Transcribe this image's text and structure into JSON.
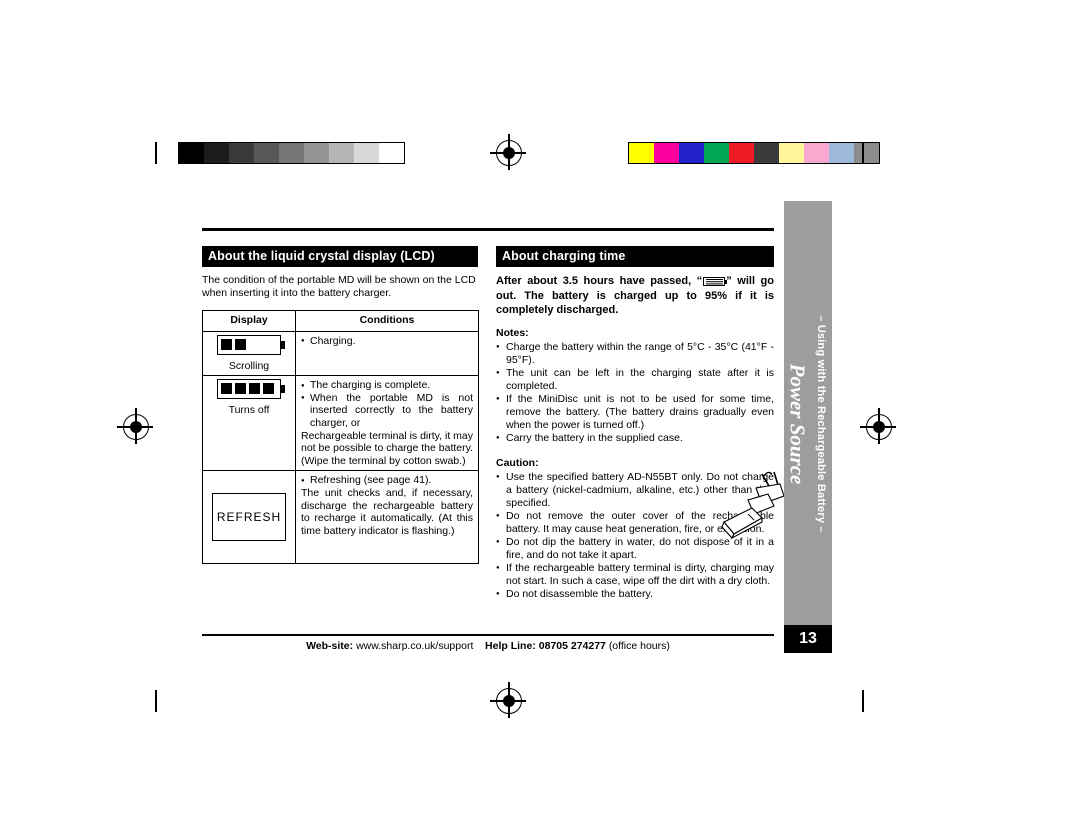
{
  "page": {
    "number": "13",
    "footer_websites_label": "Web-site:",
    "footer_website": "www.sharp.co.uk/support",
    "footer_helpline_label": "Help Line:",
    "footer_helpline": "08705 274277",
    "footer_helpline_suffix": "(office hours)"
  },
  "side_tab": {
    "title": "Power Source",
    "subtitle": "– Using with the Rechargeable Battery –"
  },
  "left": {
    "heading": "About the liquid crystal display (LCD)",
    "intro": "The condition of the portable MD will be shown on the LCD when inserting it into the battery charger.",
    "table": {
      "headers": [
        "Display",
        "Conditions"
      ],
      "rows": [
        {
          "display_icon": "battery-scrolling-icon",
          "display_label": "Scrolling",
          "conditions": [
            {
              "bullet": true,
              "text": "Charging."
            }
          ]
        },
        {
          "display_icon": "battery-off-icon",
          "display_label": "Turns off",
          "conditions": [
            {
              "bullet": true,
              "text": "The charging is complete."
            },
            {
              "bullet": true,
              "text": "When the portable MD is not inserted correctly to the battery charger, or"
            },
            {
              "bullet": false,
              "text": "Rechargeable terminal is dirty, it may not be possible to charge the battery. (Wipe the terminal by cotton swab.)"
            }
          ]
        },
        {
          "display_icon": "refresh-icon",
          "display_label": "REFRESH",
          "conditions": [
            {
              "bullet": true,
              "text": "Refreshing (see page 41)."
            },
            {
              "bullet": false,
              "text": "The unit checks and, if necessary, discharge the rechargeable battery to recharge it automatically. (At this time battery indicator is flashing.)"
            }
          ]
        }
      ]
    }
  },
  "right": {
    "heading": "About charging time",
    "intro_part1": "After about 3.5 hours have passed, “",
    "intro_icon": "battery-full-icon",
    "intro_part2": "” will go out. The battery is charged up to 95% if it is completely discharged.",
    "notes_label": "Notes:",
    "notes": [
      "Charge the battery within the range of 5°C - 35°C (41°F - 95°F).",
      "The unit can be left in the charging state after it is completed.",
      "If the MiniDisc unit is not to be used for some time, remove the battery. (The battery drains gradually even when the power is turned off.)",
      "Carry the battery in the supplied case."
    ],
    "caution_label": "Caution:",
    "cautions": [
      "Use the specified battery AD-N55BT only. Do not charge a battery (nickel-cadmium, alkaline, etc.) other than that specified.",
      "Do not remove the outer cover of the rechargeable battery. It may cause heat generation, fire, or explosion.",
      "Do not dip the battery in water, do not dispose of it in a fire, and do not take it apart.",
      "If the rechargeable battery terminal is dirty, charging may not start. In such a case, wipe off the dirt with a dry cloth.",
      "Do not disassemble the battery."
    ]
  },
  "calibration": {
    "grayscale": [
      "#000000",
      "#1c1c1c",
      "#3a3a3a",
      "#585858",
      "#767676",
      "#949494",
      "#b5b5b5",
      "#d8d8d8",
      "#ffffff"
    ],
    "colors": [
      "#ffff00",
      "#ff00a0",
      "#2222cc",
      "#00a651",
      "#ed1c24",
      "#3b3b3b",
      "#fff799",
      "#f9a8d0",
      "#9fb9dd",
      "#8c8c8c"
    ]
  }
}
